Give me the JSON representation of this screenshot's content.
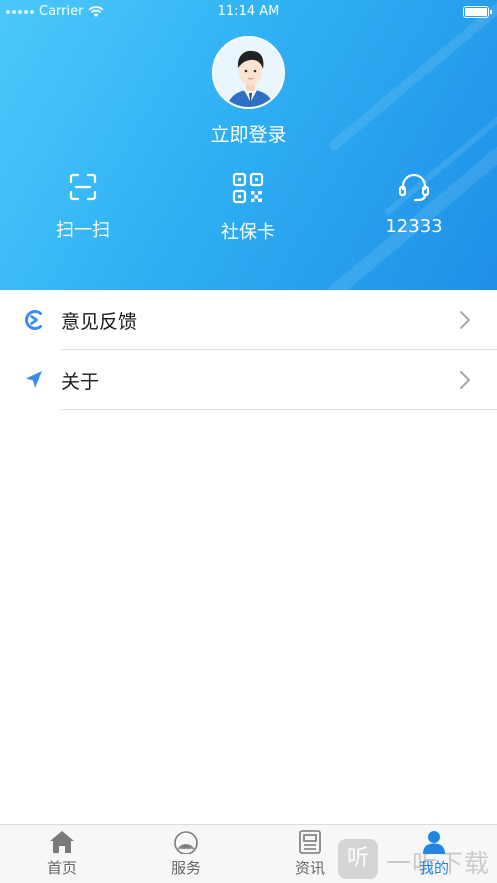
{
  "status_bar": {
    "carrier": "Carrier",
    "time": "11:14 AM"
  },
  "profile": {
    "login_text": "立即登录"
  },
  "quick_actions": [
    {
      "label": "扫一扫",
      "icon": "scan-icon"
    },
    {
      "label": "社保卡",
      "icon": "qr-code-icon"
    },
    {
      "label": "12333",
      "icon": "headset-icon"
    }
  ],
  "menu": [
    {
      "label": "意见反馈",
      "icon": "feedback-icon"
    },
    {
      "label": "关于",
      "icon": "navigation-arrow-icon"
    }
  ],
  "tabs": [
    {
      "label": "首页",
      "icon": "home-icon",
      "active": false
    },
    {
      "label": "服务",
      "icon": "service-icon",
      "active": false
    },
    {
      "label": "资讯",
      "icon": "news-icon",
      "active": false
    },
    {
      "label": "我的",
      "icon": "profile-icon",
      "active": true
    }
  ],
  "watermark": {
    "badge": "听",
    "text": "一听下载"
  },
  "colors": {
    "header_start": "#4cc9fb",
    "header_end": "#1e8fe6",
    "accent": "#1f86e4",
    "icon_blue": "#3a8ee6"
  }
}
